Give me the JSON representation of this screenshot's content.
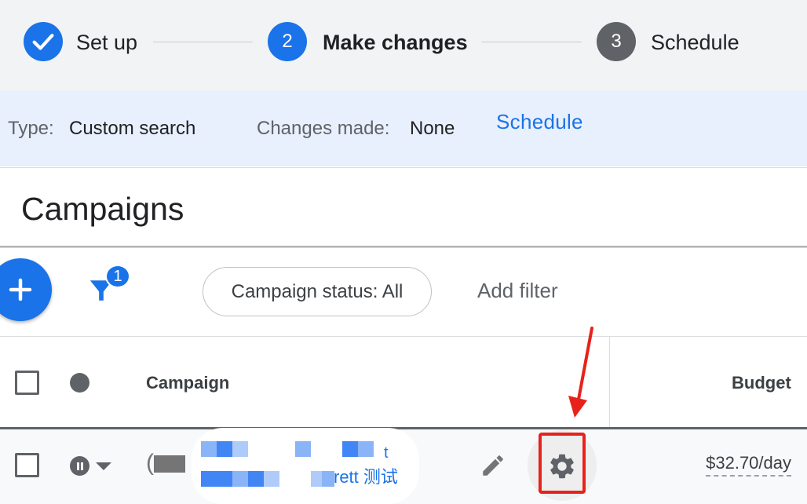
{
  "stepper": {
    "steps": [
      {
        "label": "Set up",
        "state": "done"
      },
      {
        "number": "2",
        "label": "Make changes",
        "state": "active"
      },
      {
        "number": "3",
        "label": "Schedule",
        "state": "upcoming"
      }
    ]
  },
  "info": {
    "type_label": "Type:",
    "type_value": "Custom search",
    "changes_label": "Changes made:",
    "changes_value": "None",
    "schedule_link": "Schedule"
  },
  "page_title": "Campaigns",
  "toolbar": {
    "filter_count": "1",
    "status_chip": "Campaign status: All",
    "add_filter": "Add filter"
  },
  "table": {
    "columns": {
      "campaign": "Campaign",
      "budget": "Budget"
    },
    "rows": [
      {
        "name_fragment_1": "t",
        "name_fragment_2": "rett 测试",
        "budget": "$32.70/day",
        "status": "paused"
      }
    ]
  },
  "colors": {
    "primary": "#1a73e8",
    "stepper_bg": "#f1f3f4",
    "info_bg": "#e8f0fe",
    "annotation_red": "#e8221b"
  },
  "icons": {
    "step1": "check-icon",
    "fab": "plus-icon",
    "filter": "filter-funnel-icon",
    "status_header": "status-dot-icon",
    "row_status": "pause-icon",
    "row_dropdown": "dropdown-arrow-icon",
    "edit": "pencil-icon",
    "settings": "gear-icon"
  }
}
